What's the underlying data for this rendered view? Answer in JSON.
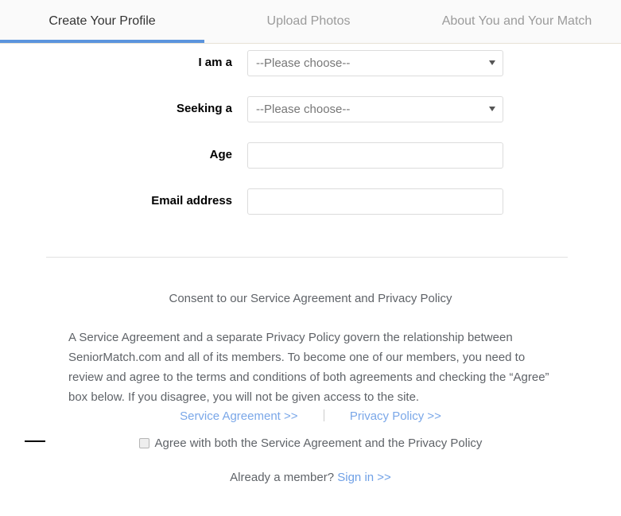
{
  "tabs": [
    {
      "label": "Create Your Profile",
      "active": true
    },
    {
      "label": "Upload Photos",
      "active": false
    },
    {
      "label": "About You and Your Match",
      "active": false
    }
  ],
  "form": {
    "fields": [
      {
        "label": "I am a",
        "type": "select",
        "value": "--Please choose--",
        "placeholder": ""
      },
      {
        "label": "Seeking a",
        "type": "select",
        "value": "--Please choose--",
        "placeholder": ""
      },
      {
        "label": "Age",
        "type": "text",
        "value": "",
        "placeholder": ""
      },
      {
        "label": "Email address",
        "type": "text",
        "value": "",
        "placeholder": ""
      }
    ]
  },
  "consent": {
    "heading": "Consent to our Service Agreement and Privacy Policy",
    "paragraph": "A Service Agreement and a separate Privacy Policy govern the relationship between SeniorMatch.com and all of its members. To become one of our members, you need to review and agree to the terms and conditions of both agreements and checking the “Agree” box below. If you disagree, you will not be given access to the site.",
    "service_agreement_link": "Service Agreement >>",
    "privacy_policy_link": "Privacy Policy >>",
    "agree_label": "Agree with both the Service Agreement and the Privacy Policy",
    "agree_checked": false
  },
  "footer": {
    "member_prompt": "Already a member?",
    "signin_link": "Sign in >>"
  },
  "colors": {
    "active_tab_underline": "#5b94dd",
    "link_blue": "#7aa7e8",
    "signin_blue": "#6fa0e6",
    "tabbar_background": "#fafafa",
    "tabbar_border": "#e7e2d6",
    "field_border": "#dcdcdc",
    "divider": "#e2e2e2",
    "body_text": "#5f6368",
    "label_text": "#000000"
  },
  "icons": {
    "select_arrow": "chevron-down-icon",
    "checkbox": "checkbox-unchecked-icon",
    "dash": "dash-marker-icon"
  }
}
